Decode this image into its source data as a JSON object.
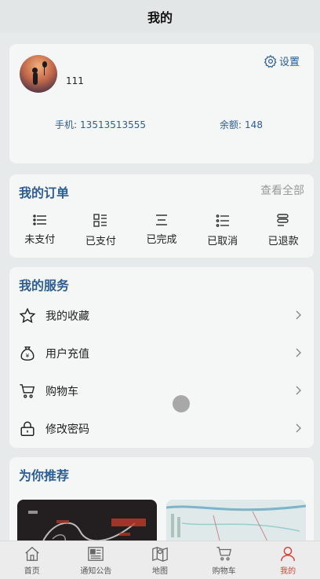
{
  "header": {
    "title": "我的"
  },
  "profile": {
    "username": "111",
    "settings_label": "设置",
    "phone_label": "手机:",
    "phone_value": "13513513555",
    "balance_label": "余额:",
    "balance_value": "148"
  },
  "orders": {
    "title": "我的订单",
    "view_all": "查看全部",
    "items": [
      {
        "label": "未支付",
        "icon": "list-icon"
      },
      {
        "label": "已支付",
        "icon": "grid-list-icon"
      },
      {
        "label": "已完成",
        "icon": "lines-icon"
      },
      {
        "label": "已取消",
        "icon": "checklist-icon"
      },
      {
        "label": "已退款",
        "icon": "stack-icon"
      }
    ]
  },
  "services": {
    "title": "我的服务",
    "items": [
      {
        "label": "我的收藏",
        "icon": "star-icon"
      },
      {
        "label": "用户充值",
        "icon": "money-bag-icon"
      },
      {
        "label": "购物车",
        "icon": "cart-icon"
      },
      {
        "label": "修改密码",
        "icon": "lock-icon"
      }
    ]
  },
  "recommend": {
    "title": "为你推荐"
  },
  "tabbar": {
    "items": [
      {
        "label": "首页",
        "icon": "home-icon"
      },
      {
        "label": "通知公告",
        "icon": "news-icon"
      },
      {
        "label": "地图",
        "icon": "map-icon"
      },
      {
        "label": "购物车",
        "icon": "cart-icon"
      },
      {
        "label": "我的",
        "icon": "user-icon"
      }
    ],
    "active_index": 4
  },
  "colors": {
    "accent": "#2b5d93",
    "active_tab": "#d6453c",
    "background": "#e6eaea",
    "card": "#f5f6f6"
  }
}
